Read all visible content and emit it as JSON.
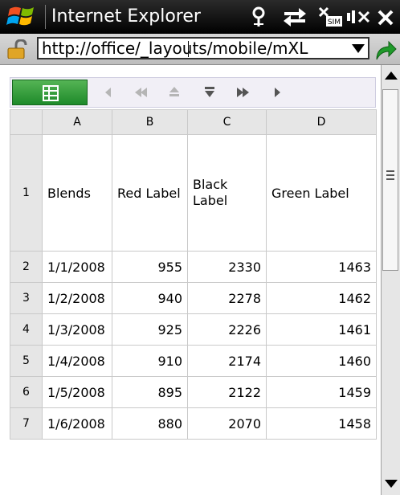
{
  "titlebar": {
    "app_title": "Internet Explorer",
    "icons": [
      "windows-logo-icon",
      "signal-icon",
      "sync-icon",
      "sim-icon",
      "volume-muted-icon",
      "close-icon"
    ]
  },
  "addressbar": {
    "url": "http://office/_layouts/mobile/mXL",
    "icons": [
      "lock-icon",
      "dropdown-arrow-icon",
      "go-arrow-icon"
    ]
  },
  "toolbar": {
    "icons": [
      "grid-icon",
      "previous-icon",
      "first-page-icon",
      "up-icon",
      "down-icon",
      "last-page-icon",
      "next-icon"
    ]
  },
  "sheet": {
    "columns": [
      "A",
      "B",
      "C",
      "D"
    ],
    "rows": [
      {
        "num": "1",
        "cells": [
          "Blends",
          "Red Label",
          "Black Label",
          "Green Label"
        ]
      },
      {
        "num": "2",
        "cells": [
          "1/1/2008",
          "955",
          "2330",
          "1463"
        ]
      },
      {
        "num": "3",
        "cells": [
          "1/2/2008",
          "940",
          "2278",
          "1462"
        ]
      },
      {
        "num": "4",
        "cells": [
          "1/3/2008",
          "925",
          "2226",
          "1461"
        ]
      },
      {
        "num": "5",
        "cells": [
          "1/4/2008",
          "910",
          "2174",
          "1460"
        ]
      },
      {
        "num": "6",
        "cells": [
          "1/5/2008",
          "895",
          "2122",
          "1459"
        ]
      },
      {
        "num": "7",
        "cells": [
          "1/6/2008",
          "880",
          "2070",
          "1458"
        ]
      }
    ]
  },
  "colors": {
    "titlebar": "#000000",
    "toolbar_grid_button": "#2e9a35",
    "go_arrow": "#1f9a2a",
    "grid_line": "#c9c9c9"
  }
}
